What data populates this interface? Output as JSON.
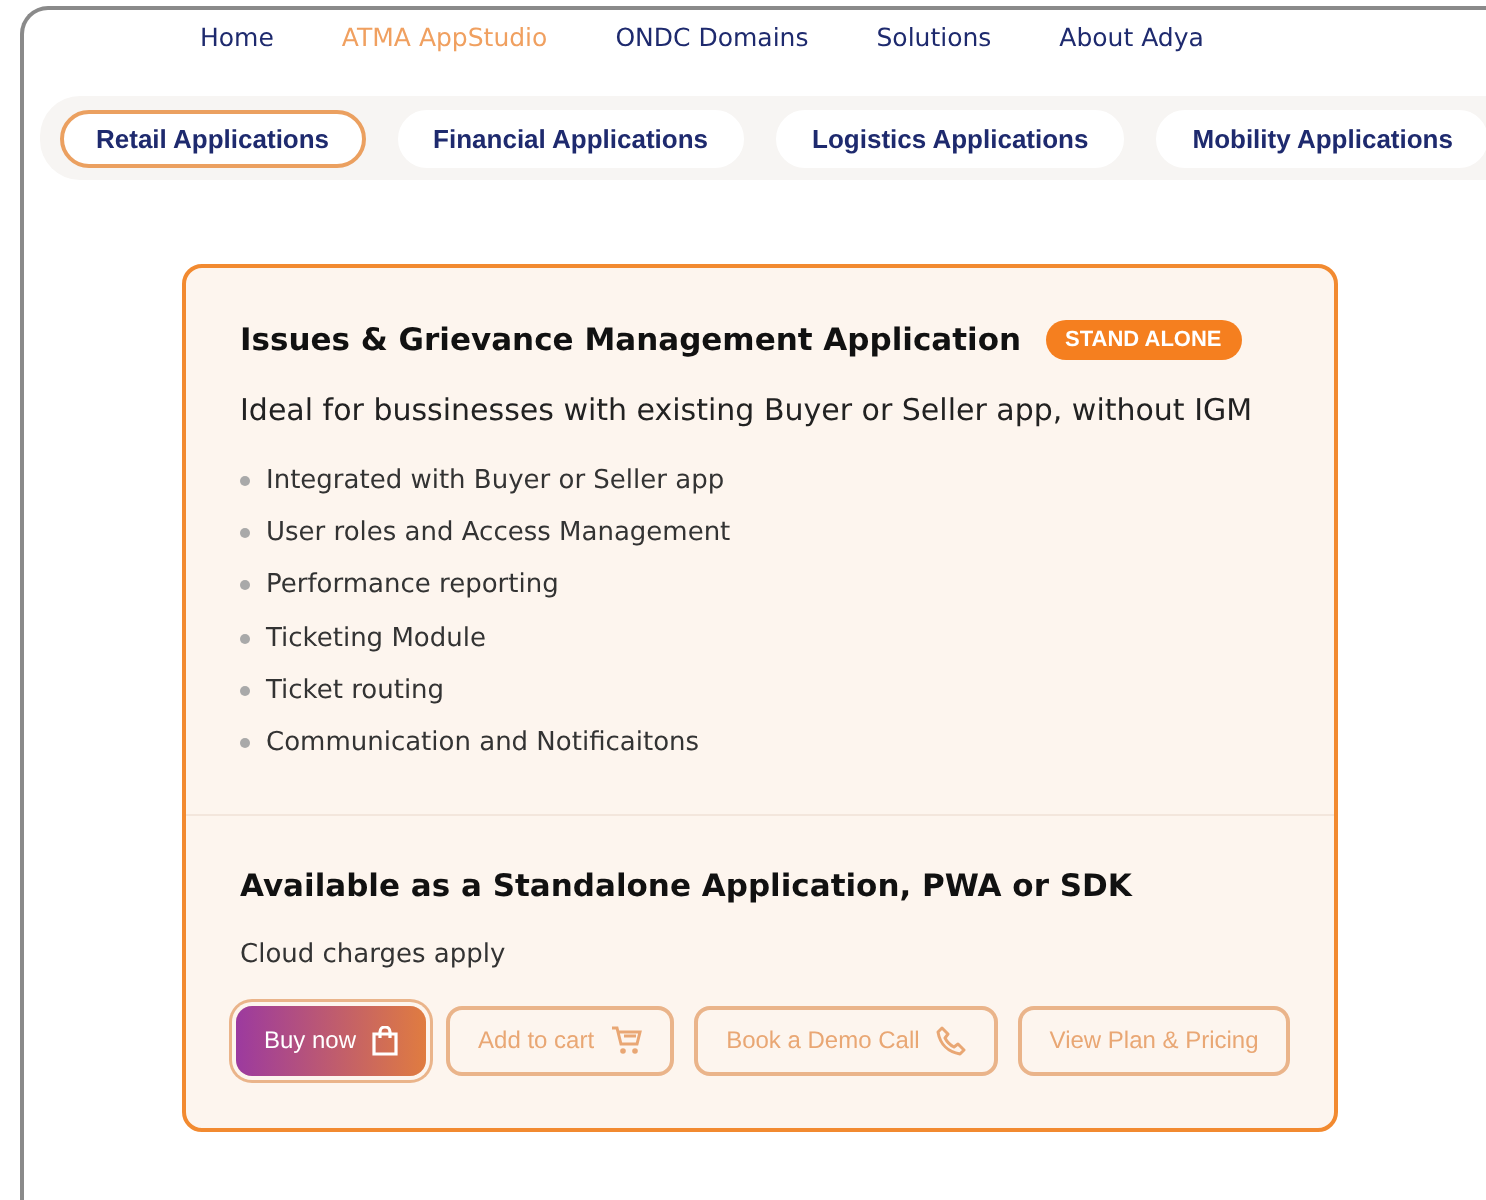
{
  "nav": [
    {
      "label": "Home",
      "selected": false
    },
    {
      "label": "ATMA AppStudio",
      "selected": true
    },
    {
      "label": "ONDC Domains",
      "selected": false
    },
    {
      "label": "Solutions",
      "selected": false
    },
    {
      "label": "About Adya",
      "selected": false
    }
  ],
  "tabs": [
    {
      "label": "Retail Applications",
      "selected": true
    },
    {
      "label": "Financial Applications",
      "selected": false
    },
    {
      "label": "Logistics Applications",
      "selected": false
    },
    {
      "label": "Mobility Applications",
      "selected": false
    }
  ],
  "card": {
    "title": "Issues & Grievance Management Application",
    "badge": "STAND ALONE",
    "subtitle": "Ideal for bussinesses with existing Buyer or Seller app, without IGM",
    "features": [
      "Integrated with Buyer or Seller app",
      "User roles and Access Management",
      "Performance reporting",
      "Ticketing Module",
      "Ticket routing",
      "Communication and Notificaitons"
    ],
    "availability": "Available as a Standalone Application, PWA or SDK",
    "note": "Cloud charges apply",
    "buttons": [
      {
        "label": "Buy now",
        "kind": "buy"
      },
      {
        "label": "Add to cart",
        "kind": "cart"
      },
      {
        "label": "Book a Demo Call",
        "kind": "call"
      },
      {
        "label": "View Plan & Pricing",
        "kind": "plain"
      }
    ]
  }
}
